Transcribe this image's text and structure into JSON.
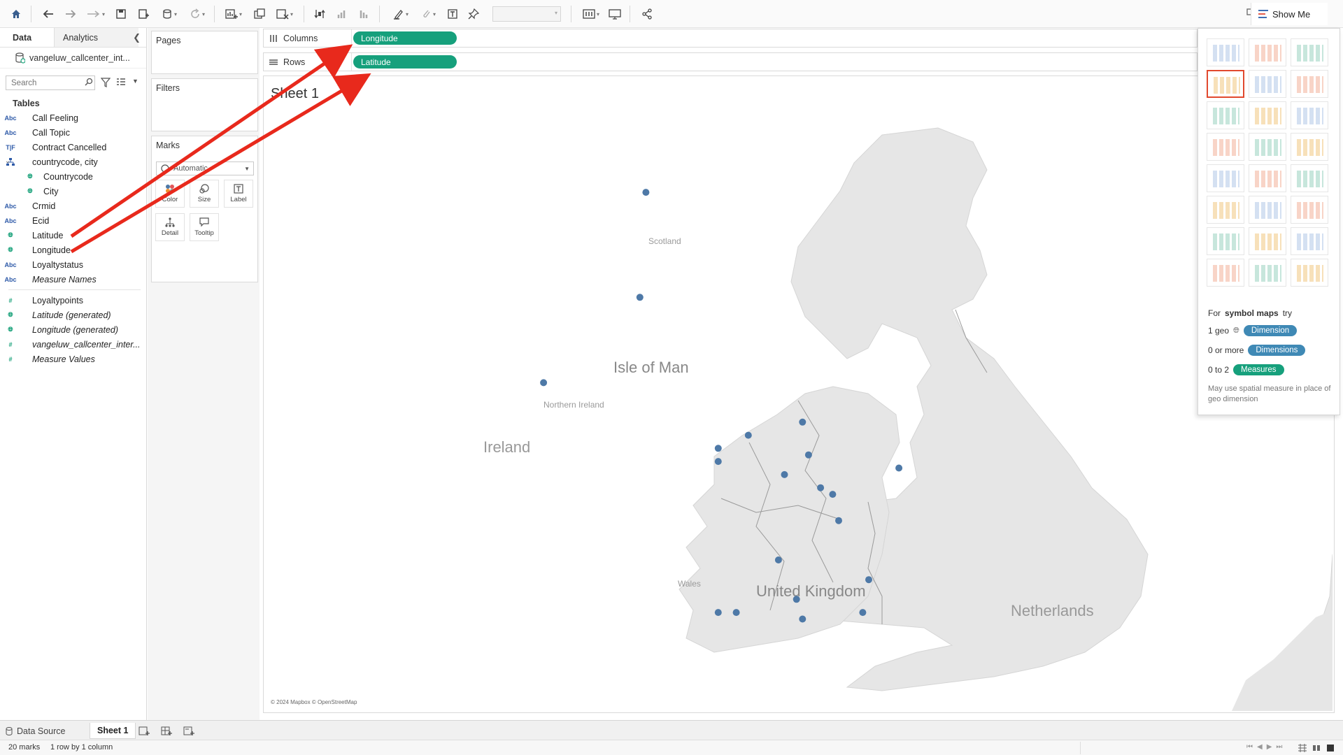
{
  "toolbar": {
    "show_me_label": "Show Me"
  },
  "data_pane": {
    "tabs": [
      "Data",
      "Analytics"
    ],
    "datasource": "vangeluw_callcenter_int...",
    "search_placeholder": "Search",
    "tables_label": "Tables",
    "fields": [
      {
        "type": "Abc",
        "label": "Call Feeling"
      },
      {
        "type": "Abc",
        "label": "Call Topic"
      },
      {
        "type": "T|F",
        "label": "Contract Cancelled"
      },
      {
        "type": "hierarchy",
        "label": "countrycode, city"
      },
      {
        "type": "geo",
        "label": "Countrycode"
      },
      {
        "type": "geo",
        "label": "City"
      },
      {
        "type": "Abc",
        "label": "Crmid"
      },
      {
        "type": "Abc",
        "label": "Ecid"
      },
      {
        "type": "geo",
        "label": "Latitude"
      },
      {
        "type": "geo",
        "label": "Longitude"
      },
      {
        "type": "Abc",
        "label": "Loyaltystatus"
      },
      {
        "type": "Abc",
        "label": "Measure Names"
      },
      {
        "type": "#",
        "label": "Loyaltypoints"
      },
      {
        "type": "geo",
        "label": "Latitude (generated)"
      },
      {
        "type": "geo",
        "label": "Longitude (generated)"
      },
      {
        "type": "#",
        "label": "vangeluw_callcenter_inter..."
      },
      {
        "type": "#",
        "label": "Measure Values"
      }
    ]
  },
  "cards": {
    "pages": "Pages",
    "filters": "Filters",
    "marks": "Marks",
    "marks_type": "Automatic",
    "mark_buttons": [
      "Color",
      "Size",
      "Label",
      "Detail",
      "Tooltip"
    ]
  },
  "shelves": {
    "columns_label": "Columns",
    "rows_label": "Rows",
    "columns_pill": "Longitude",
    "rows_pill": "Latitude"
  },
  "view": {
    "sheet_title": "Sheet 1",
    "map_labels": {
      "scotland": "Scotland",
      "northern_ireland": "Northern Ireland",
      "isle_of_man": "Isle of Man",
      "ireland": "Ireland",
      "wales": "Wales",
      "united_kingdom": "United Kingdom",
      "netherlands": "Netherlands",
      "attribution": "© 2024 Mapbox © OpenStreetMap"
    },
    "map_points": [
      [
        57.5,
        -4.2
      ],
      [
        55.9,
        -4.3
      ],
      [
        54.6,
        -5.9
      ],
      [
        54.0,
        -1.6
      ],
      [
        53.8,
        -2.5
      ],
      [
        53.6,
        -3.0
      ],
      [
        53.5,
        -1.5
      ],
      [
        53.4,
        -3.0
      ],
      [
        53.3,
        0.0
      ],
      [
        53.2,
        -1.9
      ],
      [
        53.0,
        -1.3
      ],
      [
        52.9,
        -1.1
      ],
      [
        52.5,
        -1.0
      ],
      [
        51.9,
        -2.0
      ],
      [
        51.6,
        -0.5
      ],
      [
        51.3,
        -1.7
      ],
      [
        51.1,
        -0.6
      ],
      [
        51.1,
        -3.0
      ],
      [
        51.1,
        -2.7
      ],
      [
        51.0,
        -1.6
      ]
    ]
  },
  "show_me": {
    "hint_title_pre": "For ",
    "hint_title_bold": "symbol maps",
    "hint_title_post": " try",
    "rows": [
      {
        "prefix": "1 geo",
        "pill": "Dimension",
        "color": "blue"
      },
      {
        "prefix": "0 or more",
        "pill": "Dimensions",
        "color": "blue"
      },
      {
        "prefix": "0 to 2",
        "pill": "Measures",
        "color": "green"
      }
    ],
    "note": "May use spatial measure in place of geo dimension"
  },
  "sheet_tabs": {
    "data_source": "Data Source",
    "sheet": "Sheet 1"
  },
  "status": {
    "marks": "20 marks",
    "layout": "1 row by 1 column"
  },
  "colors": {
    "pill_green": "#16a07c",
    "pill_blue": "#3f89b5",
    "mark_blue": "#4e79a7",
    "annotation_red": "#e8291c",
    "land": "#e6e6e6",
    "sea": "#ffffff"
  }
}
